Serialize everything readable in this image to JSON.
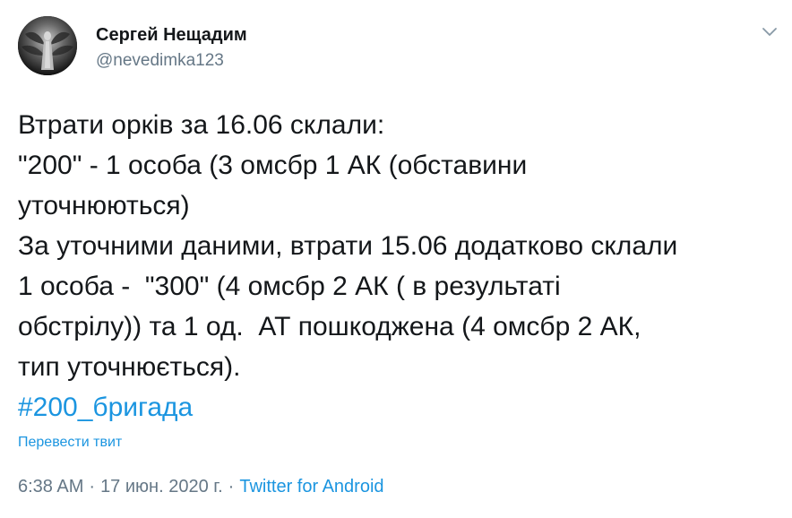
{
  "author": {
    "display_name": "Сергей Нещадим",
    "handle": "@nevedimka123",
    "avatar_icon": "avatar-angel-statue"
  },
  "tweet": {
    "lines": [
      "Втрати орків за 16.06 склали:",
      "\"200\" - 1 особа (3 омсбр 1 АК (обставини",
      "уточнюються)",
      "За уточними даними, втрати 15.06 додатково склали",
      "1 особа -  \"300\" (4 омсбр 2 АК ( в результаті",
      "обстрілу)) та 1 од.  АТ пошкоджена (4 омсбр 2 АК,",
      "тип уточнюється)."
    ],
    "hashtag": "#200_бригада",
    "translate_label": "Перевести твит",
    "time": "6:38 AM",
    "date": "17 июн. 2020 г.",
    "separator": "·",
    "source": "Twitter for Android"
  },
  "icons": {
    "menu": "chevron-down-icon"
  },
  "colors": {
    "text": "#14171a",
    "secondary": "#657786",
    "link": "#1b95e0"
  }
}
